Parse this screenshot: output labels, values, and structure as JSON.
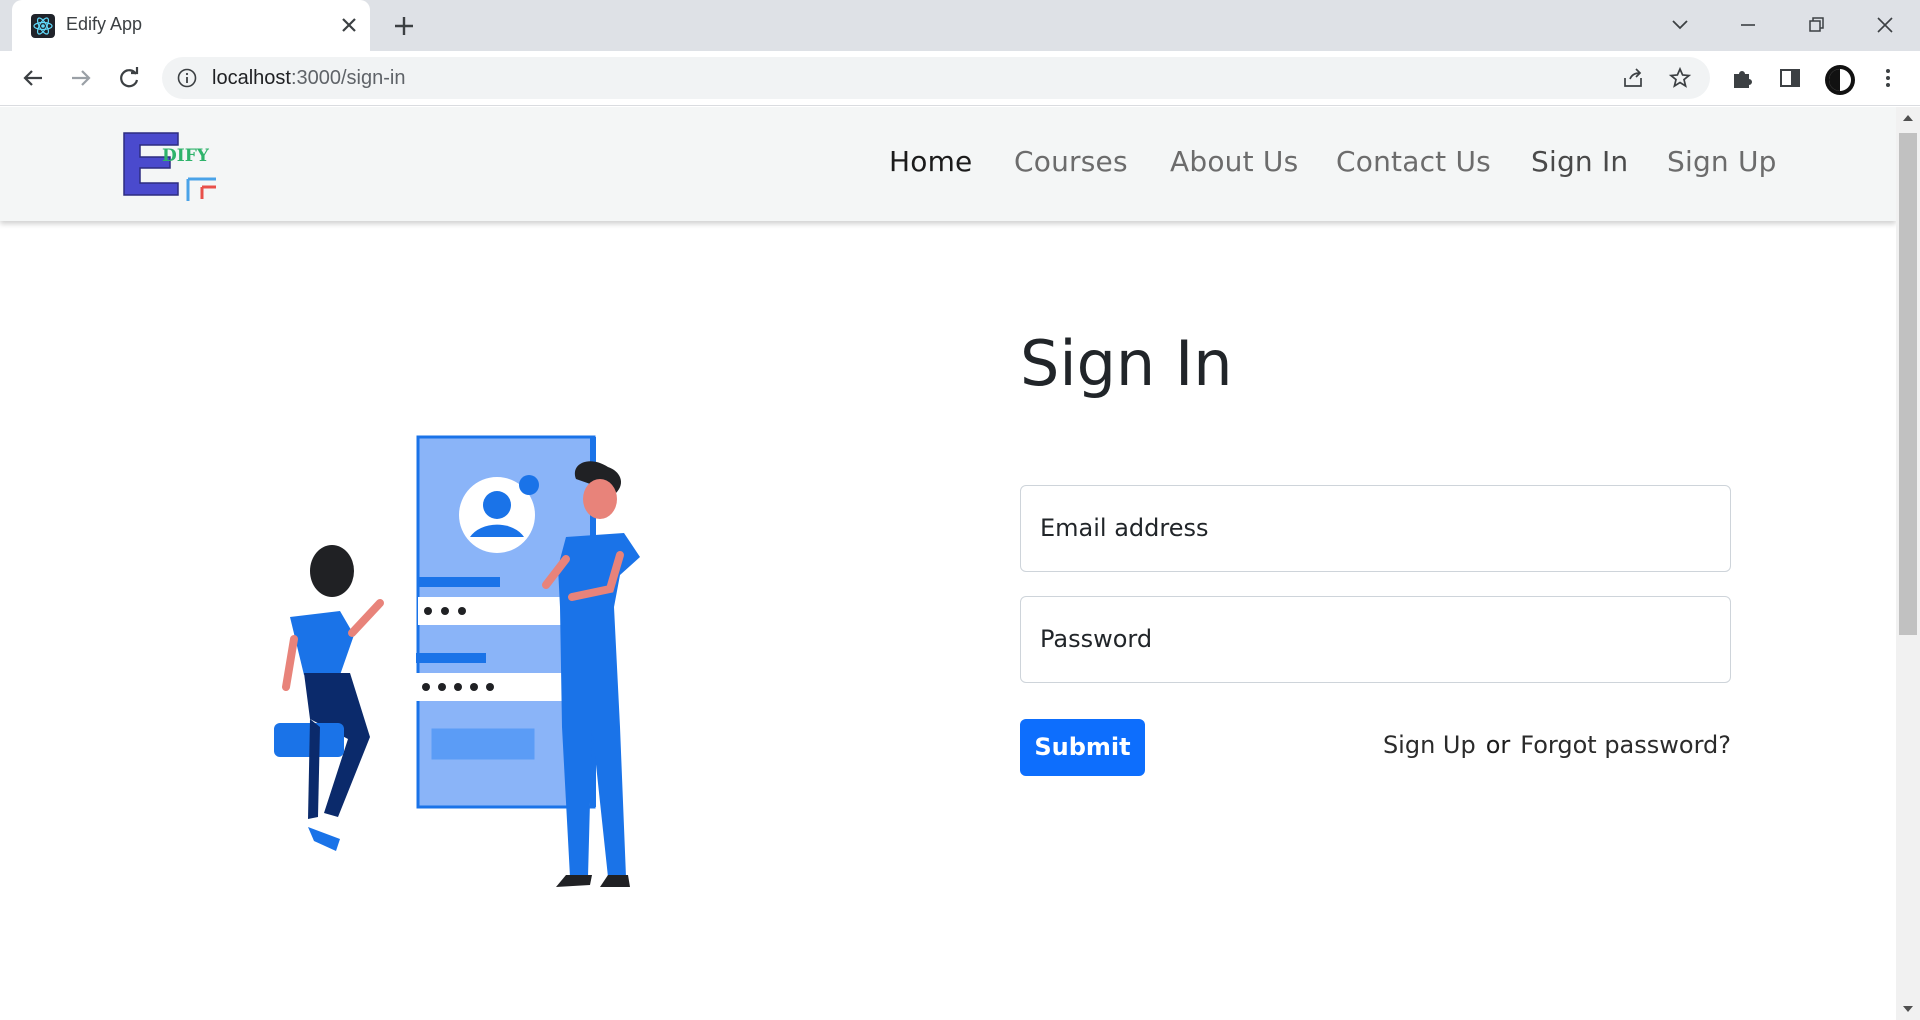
{
  "browser": {
    "tab_title": "Edify App",
    "url_host": "localhost",
    "url_path": ":3000/sign-in"
  },
  "logo": {
    "letter": "E",
    "text": "DIFY"
  },
  "nav": {
    "items": [
      {
        "label": "Home"
      },
      {
        "label": "Courses"
      },
      {
        "label": "About Us"
      },
      {
        "label": "Contact Us"
      },
      {
        "label": "Sign In"
      },
      {
        "label": "Sign Up"
      }
    ]
  },
  "form": {
    "title": "Sign In",
    "email_label": "Email address",
    "password_label": "Password",
    "submit_label": "Submit",
    "signup_link": "Sign Up",
    "or_text": "or",
    "forgot_link": "Forgot password?"
  },
  "colors": {
    "primary": "#0d6efd",
    "navbar_bg": "#f4f6f6",
    "illustration_blue": "#1a73e8",
    "logo_blue": "#4a4acd",
    "logo_green": "#2fb36b"
  }
}
